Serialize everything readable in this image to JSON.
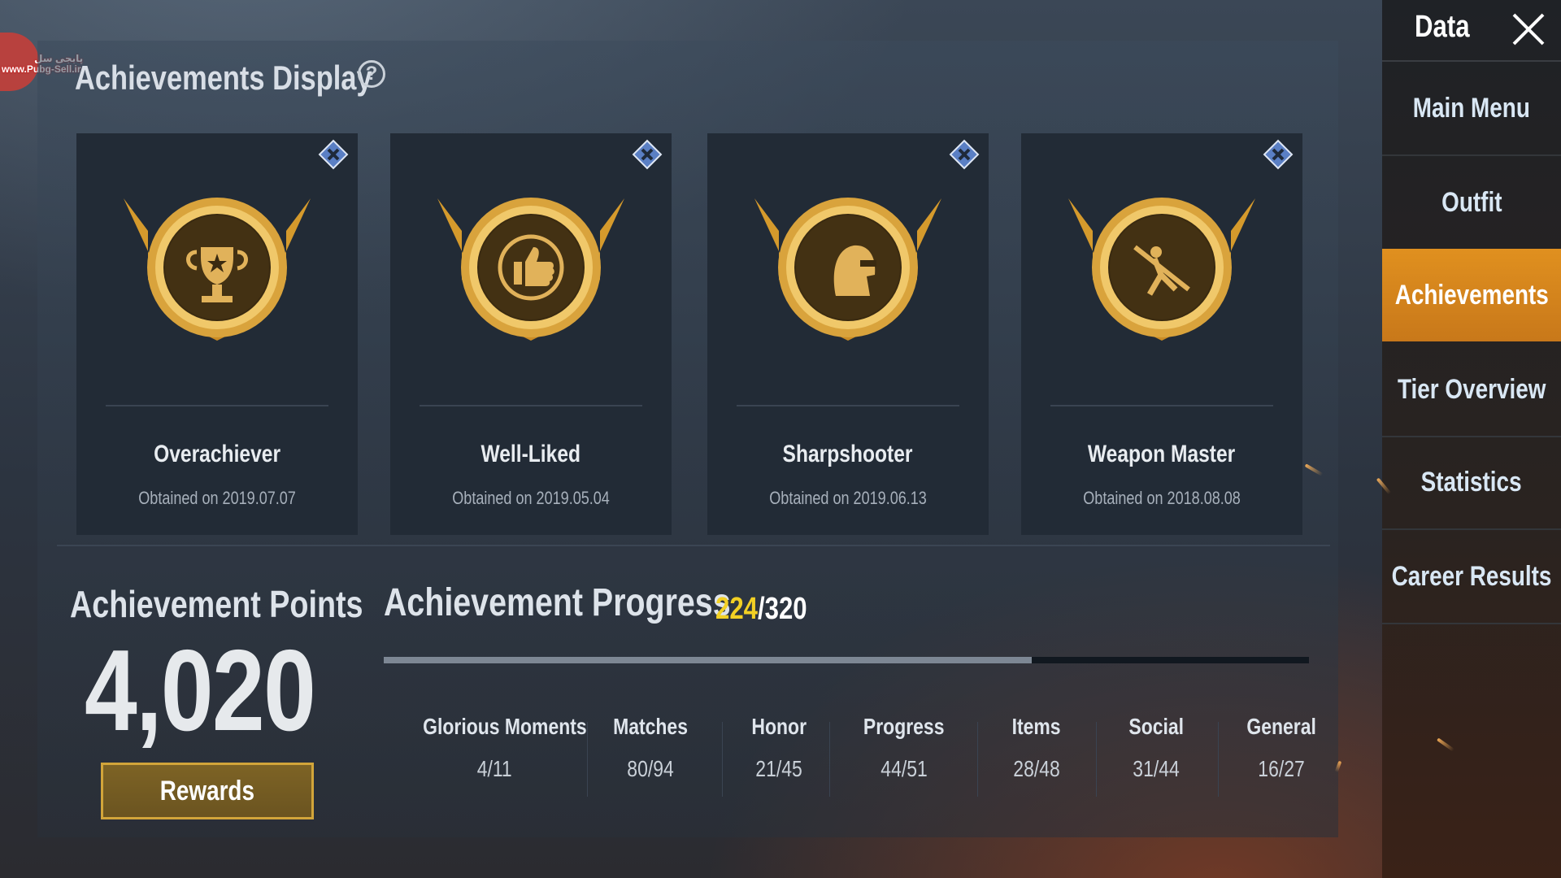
{
  "watermark": {
    "line1": "پابجی سل",
    "line2": "www.Pubg-Sell.ir"
  },
  "display": {
    "title": "Achievements Display",
    "help_icon": "question-circle-icon"
  },
  "cards": [
    {
      "name": "Overachiever",
      "date": "Obtained on 2019.07.07",
      "emblem": "trophy-icon"
    },
    {
      "name": "Well-Liked",
      "date": "Obtained on 2019.05.04",
      "emblem": "thumbs-up-icon"
    },
    {
      "name": "Sharpshooter",
      "date": "Obtained on 2019.06.13",
      "emblem": "helmet-icon"
    },
    {
      "name": "Weapon Master",
      "date": "Obtained on 2018.08.08",
      "emblem": "weapon-master-icon"
    }
  ],
  "points": {
    "label": "Achievement Points",
    "value": "4,020",
    "rewards_label": "Rewards"
  },
  "progress": {
    "label": "Achievement Progress",
    "current": "224",
    "total": "/320",
    "fraction": 0.7
  },
  "categories": [
    {
      "label": "Glorious Moments",
      "value": "4/11"
    },
    {
      "label": "Matches",
      "value": "80/94"
    },
    {
      "label": "Honor",
      "value": "21/45"
    },
    {
      "label": "Progress",
      "value": "44/51"
    },
    {
      "label": "Items",
      "value": "28/48"
    },
    {
      "label": "Social",
      "value": "31/44"
    },
    {
      "label": "General",
      "value": "16/27"
    }
  ],
  "menu": {
    "title": "Data",
    "items": [
      "Main Menu",
      "Outfit",
      "Achievements",
      "Tier Overview",
      "Statistics",
      "Career Results"
    ],
    "active_index": 2
  },
  "colors": {
    "accent": "#e0901f",
    "progress_highlight": "#f2d024",
    "gold": "#d2a53a"
  }
}
